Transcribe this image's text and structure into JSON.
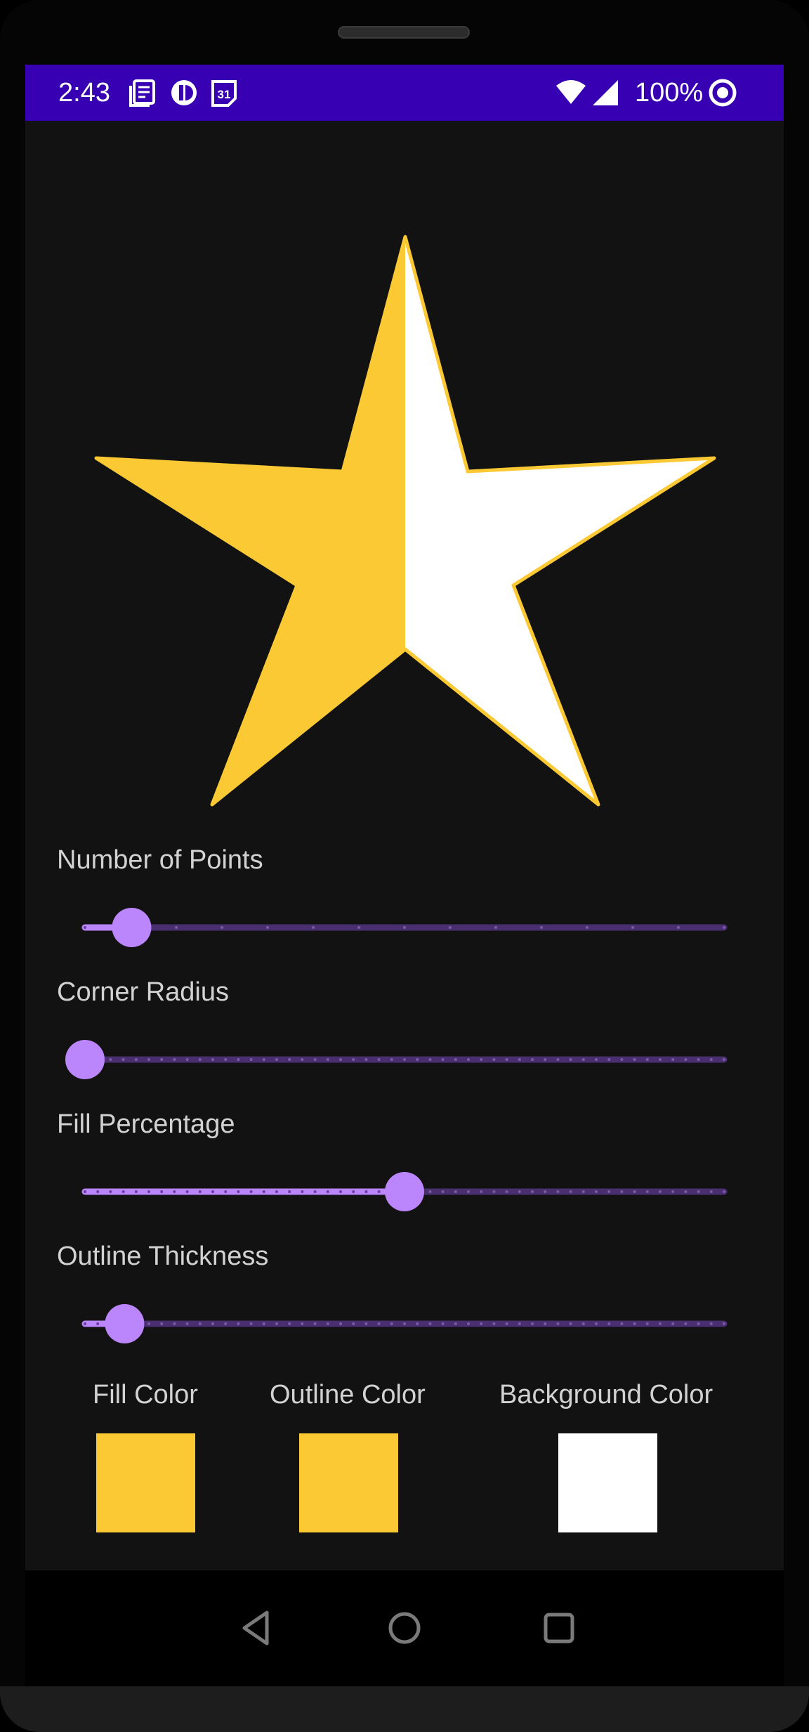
{
  "status_bar": {
    "time": "2:43",
    "battery": "100%",
    "icons": [
      "news-icon",
      "app-icon",
      "calendar-icon",
      "wifi-icon",
      "signal-icon",
      "sync-icon"
    ]
  },
  "star": {
    "points": 5,
    "fill_percentage": 0.5,
    "fill_color": "#fbc933",
    "outline_color": "#fbc933",
    "background_color": "#ffffff"
  },
  "sliders": [
    {
      "id": "points",
      "label": "Number of Points",
      "value": 0.073,
      "ticks": 14
    },
    {
      "id": "corner",
      "label": "Corner Radius",
      "value": 0.0,
      "ticks": 50
    },
    {
      "id": "fill",
      "label": "Fill Percentage",
      "value": 0.5,
      "ticks": 50
    },
    {
      "id": "outline",
      "label": "Outline Thickness",
      "value": 0.062,
      "ticks": 50
    }
  ],
  "swatches": {
    "fill_label": "Fill Color",
    "outline_label": "Outline Color",
    "background_label": "Background Color",
    "fill_color": "#fbc933",
    "outline_color": "#fbc933",
    "background_color": "#ffffff"
  },
  "colors": {
    "accent": "#bb86fc",
    "accent_dim": "#4a2f70",
    "status_bar": "#3700b3",
    "screen_bg": "#121212"
  },
  "nav": {
    "icons": [
      "back-icon",
      "home-icon",
      "recents-icon"
    ]
  }
}
